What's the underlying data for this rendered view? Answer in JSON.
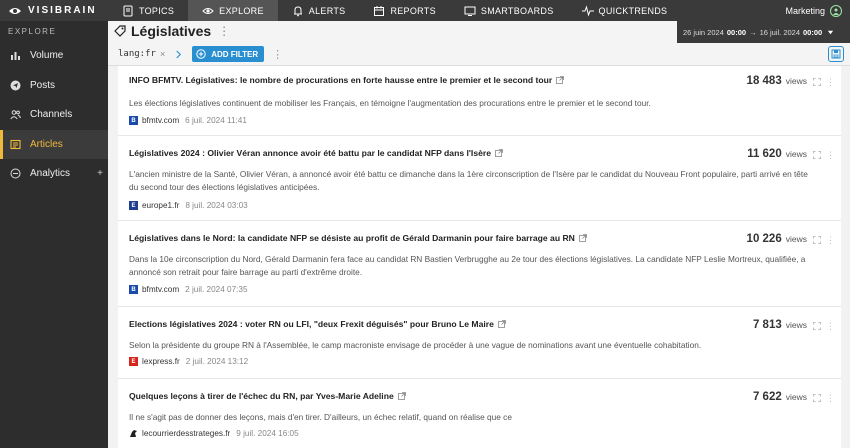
{
  "nav": {
    "logo": "VISIBRAIN",
    "items": [
      {
        "label": "TOPICS",
        "icon": "document-icon"
      },
      {
        "label": "EXPLORE",
        "icon": "eye-icon",
        "active": true
      },
      {
        "label": "ALERTS",
        "icon": "bell-icon"
      },
      {
        "label": "REPORTS",
        "icon": "calendar-icon"
      },
      {
        "label": "SMARTBOARDS",
        "icon": "monitor-icon"
      },
      {
        "label": "QUICKTRENDS",
        "icon": "pulse-icon"
      }
    ],
    "account": "Marketing"
  },
  "sidebar": {
    "heading": "EXPLORE",
    "items": [
      {
        "label": "Volume",
        "icon": "bar-chart-icon"
      },
      {
        "label": "Posts",
        "icon": "send-icon"
      },
      {
        "label": "Channels",
        "icon": "users-icon"
      },
      {
        "label": "Articles",
        "icon": "newspaper-icon",
        "active": true
      },
      {
        "label": "Analytics",
        "icon": "analytics-icon",
        "expandable": "+"
      }
    ]
  },
  "header": {
    "title": "Législatives",
    "more": "⋮",
    "date_start": "26 juin 2024",
    "time_start": "00:00",
    "arrow": "→",
    "date_end": "16 juil. 2024",
    "time_end": "00:00"
  },
  "filters": {
    "chip": "lang:fr",
    "chip_remove": "×",
    "add_label": "ADD FILTER"
  },
  "colors": {
    "accent": "#2a8fd0",
    "active": "#f0b93a",
    "topbar": "#3a3a3a",
    "sidebar": "#2d2d2d"
  },
  "articles": [
    {
      "title": "INFO BFMTV. Législatives: le nombre de procurations en forte hausse entre le premier et le second tour",
      "views": "18 483",
      "views_label": "views",
      "desc": "Les élections législatives continuent de mobiliser les Français, en témoigne l'augmentation des procurations entre le premier et le second tour.",
      "source": "bfmtv.com",
      "date": "6 juil. 2024 11:41"
    },
    {
      "title": "Législatives 2024 : Olivier Véran annonce avoir été battu par le candidat NFP dans l'Isère",
      "views": "11 620",
      "views_label": "views",
      "desc": "L'ancien ministre de la Santé, Olivier Véran, a annoncé avoir été battu ce dimanche dans la 1ère circonscription de l'Isère par le candidat du Nouveau Front populaire, parti arrivé en tête du second tour des élections législatives anticipées.",
      "source": "europe1.fr",
      "date": "8 juil. 2024 03:03"
    },
    {
      "title": "Législatives dans le Nord: la candidate NFP se désiste au profit de Gérald Darmanin pour faire barrage au RN",
      "views": "10 226",
      "views_label": "views",
      "desc": "Dans la 10e circonscription du Nord, Gérald Darmanin fera face au candidat RN Bastien Verbrugghe au 2e tour des élections législatives. La candidate NFP Leslie Mortreux, qualifiée, a annoncé son retrait pour faire barrage au parti d'extrême droite.",
      "source": "bfmtv.com",
      "date": "2 juil. 2024 07:35"
    },
    {
      "title": "Elections législatives 2024 : voter RN ou LFI, \"deux Frexit déguisés\" pour Bruno Le Maire",
      "views": "7 813",
      "views_label": "views",
      "desc": "Selon la présidente du groupe RN à l'Assemblée, le camp macroniste envisage de procéder à une vague de nominations avant une éventuelle cohabitation.",
      "source": "lexpress.fr",
      "date": "2 juil. 2024 13:12"
    },
    {
      "title": "Quelques leçons à tirer de l'échec du RN, par Yves-Marie Adeline",
      "views": "7 622",
      "views_label": "views",
      "desc": "Il ne s'agit pas de donner des leçons, mais d'en tirer. D'ailleurs, un échec relatif, quand on réalise que ce",
      "source": "lecourrierdesstrateges.fr",
      "date": "9 juil. 2024 16:05"
    }
  ]
}
